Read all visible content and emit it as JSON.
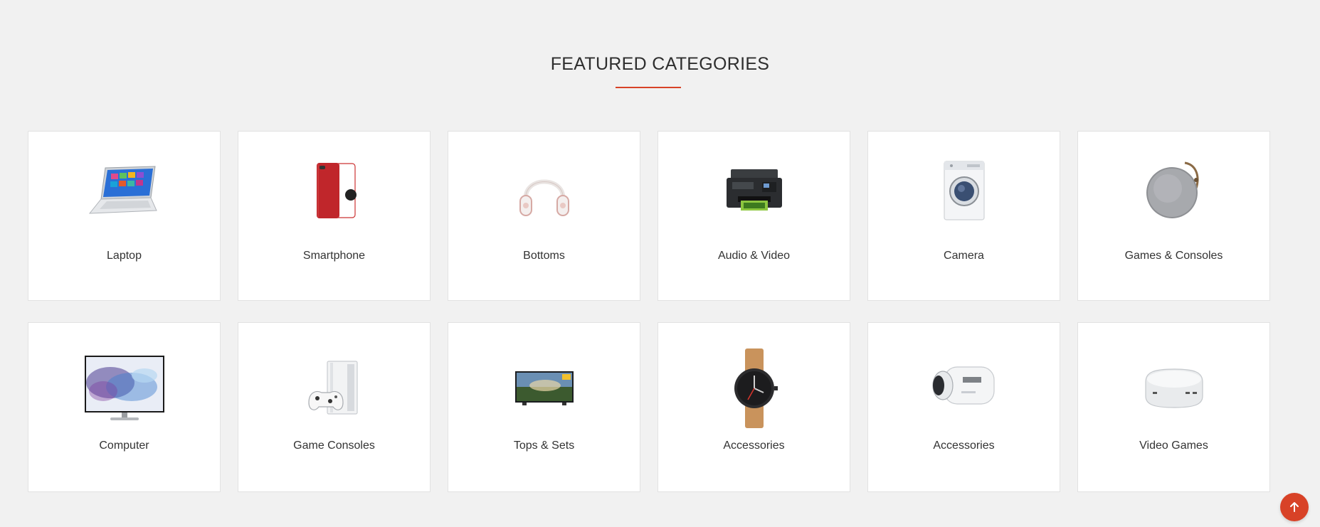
{
  "section": {
    "title": "FEATURED CATEGORIES",
    "accent_color": "#d84227"
  },
  "categories": [
    {
      "label": "Laptop",
      "icon": "laptop-icon"
    },
    {
      "label": "Smartphone",
      "icon": "smartphone-icon"
    },
    {
      "label": "Bottoms",
      "icon": "headphones-icon"
    },
    {
      "label": "Audio & Video",
      "icon": "printer-icon"
    },
    {
      "label": "Camera",
      "icon": "washing-machine-icon"
    },
    {
      "label": "Games & Consoles",
      "icon": "speaker-icon"
    },
    {
      "label": "Computer",
      "icon": "monitor-icon"
    },
    {
      "label": "Game Consoles",
      "icon": "game-console-icon"
    },
    {
      "label": "Tops & Sets",
      "icon": "tv-icon"
    },
    {
      "label": "Accessories",
      "icon": "watch-icon"
    },
    {
      "label": "Accessories",
      "icon": "action-camera-icon"
    },
    {
      "label": "Video Games",
      "icon": "mini-pc-icon"
    }
  ],
  "scroll_top": {
    "icon": "arrow-up-icon"
  }
}
